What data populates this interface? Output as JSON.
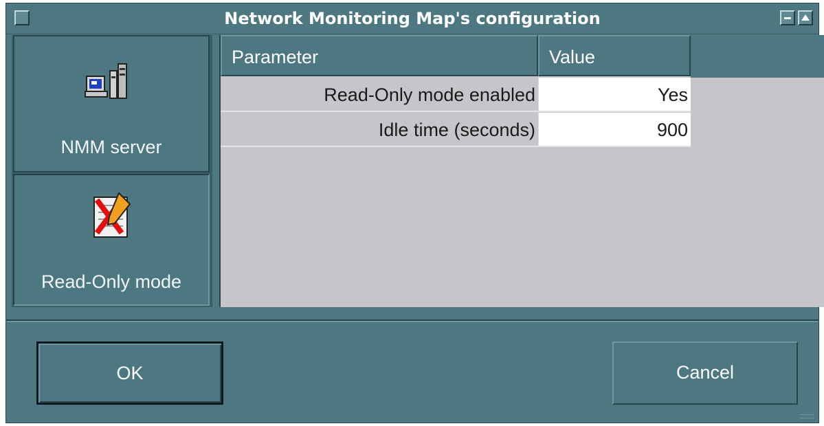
{
  "window": {
    "title": "Network Monitoring Map's configuration"
  },
  "sidebar": {
    "items": [
      {
        "label": "NMM server",
        "icon": "computer-server-icon"
      },
      {
        "label": "Read-Only mode",
        "icon": "read-only-edit-icon"
      }
    ]
  },
  "table": {
    "headers": {
      "parameter": "Parameter",
      "value": "Value"
    },
    "rows": [
      {
        "parameter": "Read-Only mode enabled",
        "value": "Yes"
      },
      {
        "parameter": "Idle time (seconds)",
        "value": "900"
      }
    ]
  },
  "buttons": {
    "ok": "OK",
    "cancel": "Cancel"
  },
  "colors": {
    "window_bg": "#4d7781",
    "table_bg": "#c6c5c9",
    "value_cell_bg": "#ffffff"
  }
}
